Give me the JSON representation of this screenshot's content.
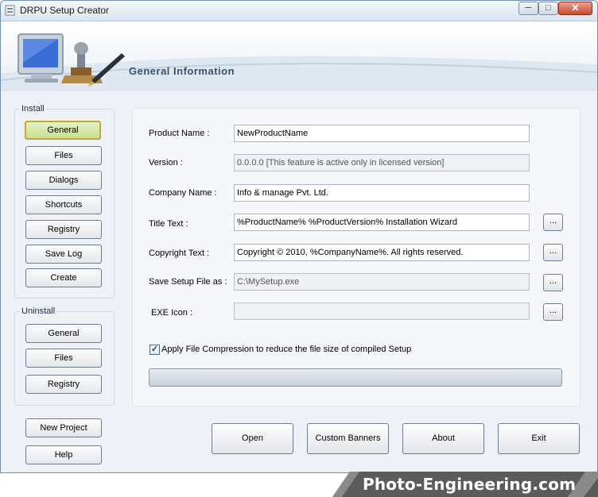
{
  "window": {
    "title": "DRPU Setup Creator",
    "minimize_label": "─",
    "maximize_label": "□",
    "close_label": "✕"
  },
  "banner": {
    "title": "General Information"
  },
  "sidebar": {
    "install": {
      "label": "Install",
      "items": [
        {
          "label": "General",
          "active": true
        },
        {
          "label": "Files"
        },
        {
          "label": "Dialogs"
        },
        {
          "label": "Shortcuts"
        },
        {
          "label": "Registry"
        },
        {
          "label": "Save Log"
        },
        {
          "label": "Create"
        }
      ]
    },
    "uninstall": {
      "label": "Uninstall",
      "items": [
        {
          "label": "General"
        },
        {
          "label": "Files"
        },
        {
          "label": "Registry"
        }
      ]
    },
    "new_project_label": "New Project",
    "help_label": "Help"
  },
  "form": {
    "product_name": {
      "label": "Product Name :",
      "value": "NewProductName"
    },
    "version": {
      "label": "Version :",
      "value": "0.0.0.0 [This feature is active only in licensed version]"
    },
    "company_name": {
      "label": "Company Name :",
      "value": "Info & manage Pvt. Ltd."
    },
    "title_text": {
      "label": "Title Text :",
      "value": "%ProductName% %ProductVersion% Installation Wizard"
    },
    "copyright_text": {
      "label": "Copyright Text :",
      "value": "Copyright © 2010, %CompanyName%. All rights reserved."
    },
    "save_setup": {
      "label": "Save Setup File as :",
      "value": "C:\\MySetup.exe"
    },
    "exe_icon": {
      "label": "EXE Icon :",
      "value": ""
    },
    "browse_label": "...",
    "compression": {
      "label": "Apply File Compression to reduce the file size of compiled Setup",
      "checked": true,
      "check_mark": "✓"
    },
    "progress": 0
  },
  "footer_buttons": {
    "open": "Open",
    "custom_banners": "Custom Banners",
    "about": "About",
    "exit": "Exit"
  },
  "watermark": {
    "text": "Photo-Engineering.com"
  },
  "colors": {
    "accent": "#36506f",
    "active_button": "#c7e08c",
    "close_button": "#c94a2f"
  }
}
